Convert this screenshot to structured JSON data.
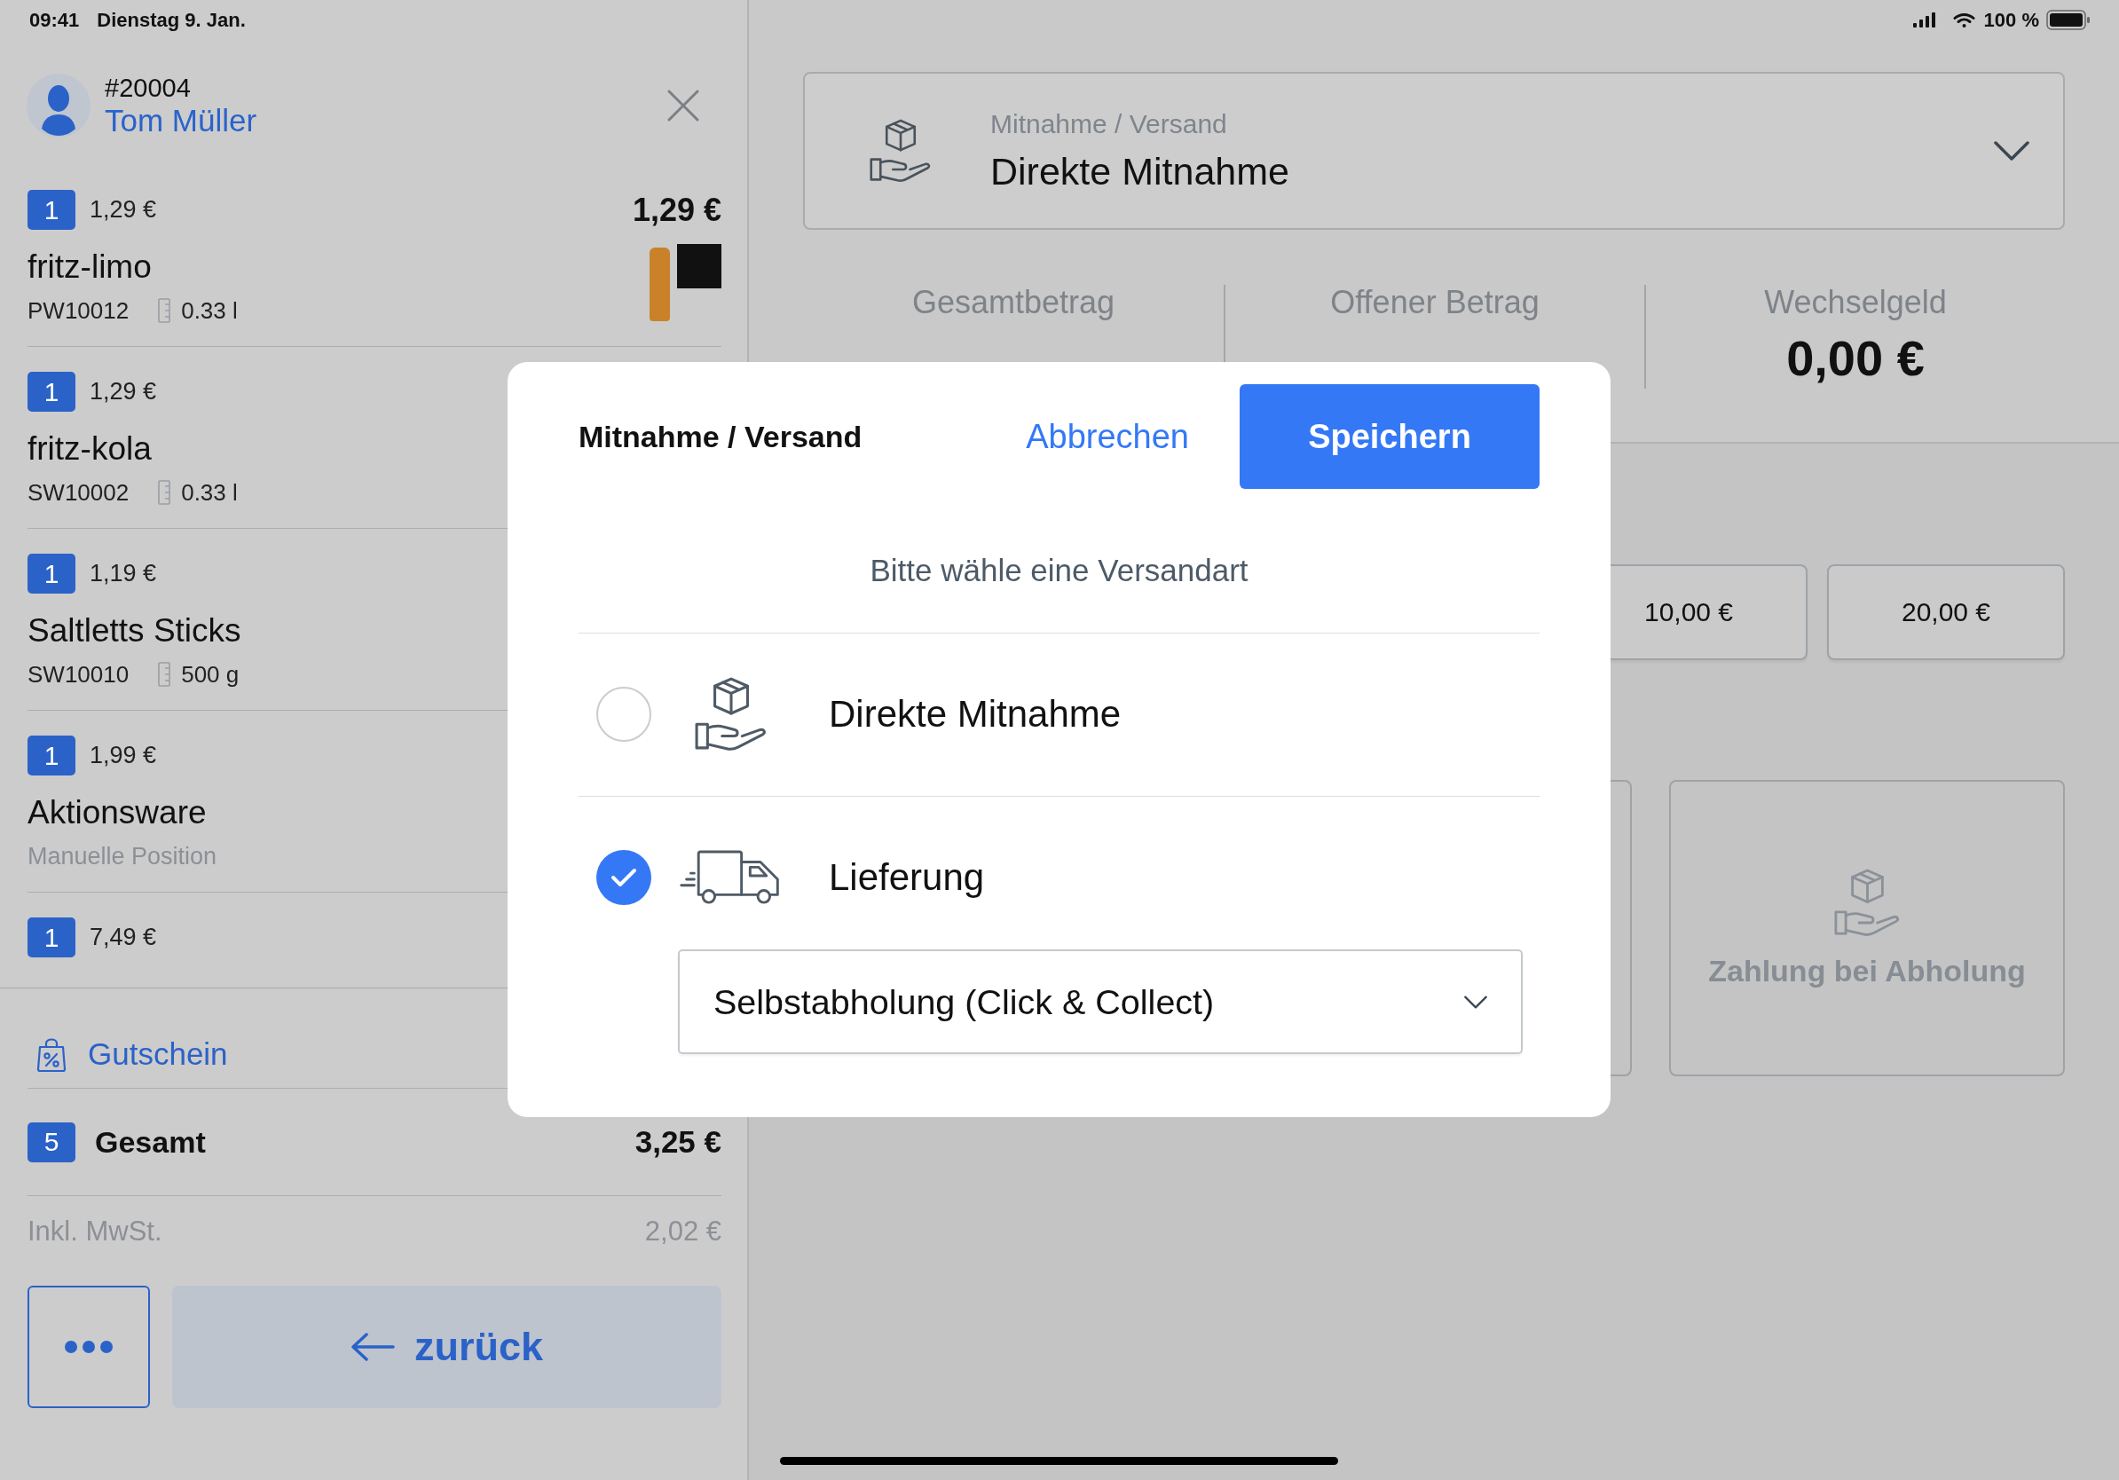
{
  "status_bar": {
    "time": "09:41",
    "date": "Dienstag 9. Jan.",
    "battery": "100 %"
  },
  "order": {
    "number": "#20004",
    "customer": "Tom Müller"
  },
  "items": [
    {
      "kind": "pictured",
      "quantity": "1",
      "unit_price": "1,29 €",
      "total": "1,29 €",
      "name": "fritz-limo",
      "sku": "PW10012",
      "size": "0.33 l"
    },
    {
      "kind": "product",
      "quantity": "1",
      "unit_price": "1,29 €",
      "name": "fritz-kola",
      "sku": "SW10002",
      "size": "0.33 l"
    },
    {
      "kind": "product",
      "quantity": "1",
      "unit_price": "1,19 €",
      "name": "Saltletts Sticks",
      "sku": "SW10010",
      "size": "500 g"
    },
    {
      "kind": "manual",
      "quantity": "1",
      "unit_price": "1,99 €",
      "name": "Aktionsware",
      "note": "Manuelle Position"
    },
    {
      "kind": "product",
      "quantity": "1",
      "unit_price": "7,49 €"
    }
  ],
  "voucher": {
    "label": "Gutschein"
  },
  "total": {
    "count": "5",
    "label": "Gesamt",
    "amount": "3,25 €"
  },
  "tax": {
    "label": "Inkl. MwSt.",
    "amount": "2,02 €"
  },
  "back_button": {
    "label": "zurück"
  },
  "shipping_select": {
    "label": "Mitnahme / Versand",
    "value": "Direkte Mitnahme"
  },
  "summary": [
    {
      "label": "Gesamtbetrag"
    },
    {
      "label": "Offener Betrag"
    },
    {
      "label": "Wechselgeld",
      "value": "0,00 €"
    }
  ],
  "cash_buttons": [
    "10,00 €",
    "20,00 €"
  ],
  "payment_tiles": [
    {
      "kind": "blank"
    },
    {
      "kind": "pickup",
      "label": "Zahlung bei Abholung"
    }
  ],
  "dialog": {
    "title": "Mitnahme / Versand",
    "cancel": "Abbrechen",
    "save": "Speichern",
    "prompt": "Bitte wähle eine Versandart",
    "options": [
      {
        "kind": "pickup",
        "label": "Direkte Mitnahme",
        "selected": false
      },
      {
        "kind": "delivery",
        "label": "Lieferung",
        "selected": true
      }
    ],
    "delivery_method": {
      "value": "Selbstabholung (Click & Collect)"
    }
  }
}
